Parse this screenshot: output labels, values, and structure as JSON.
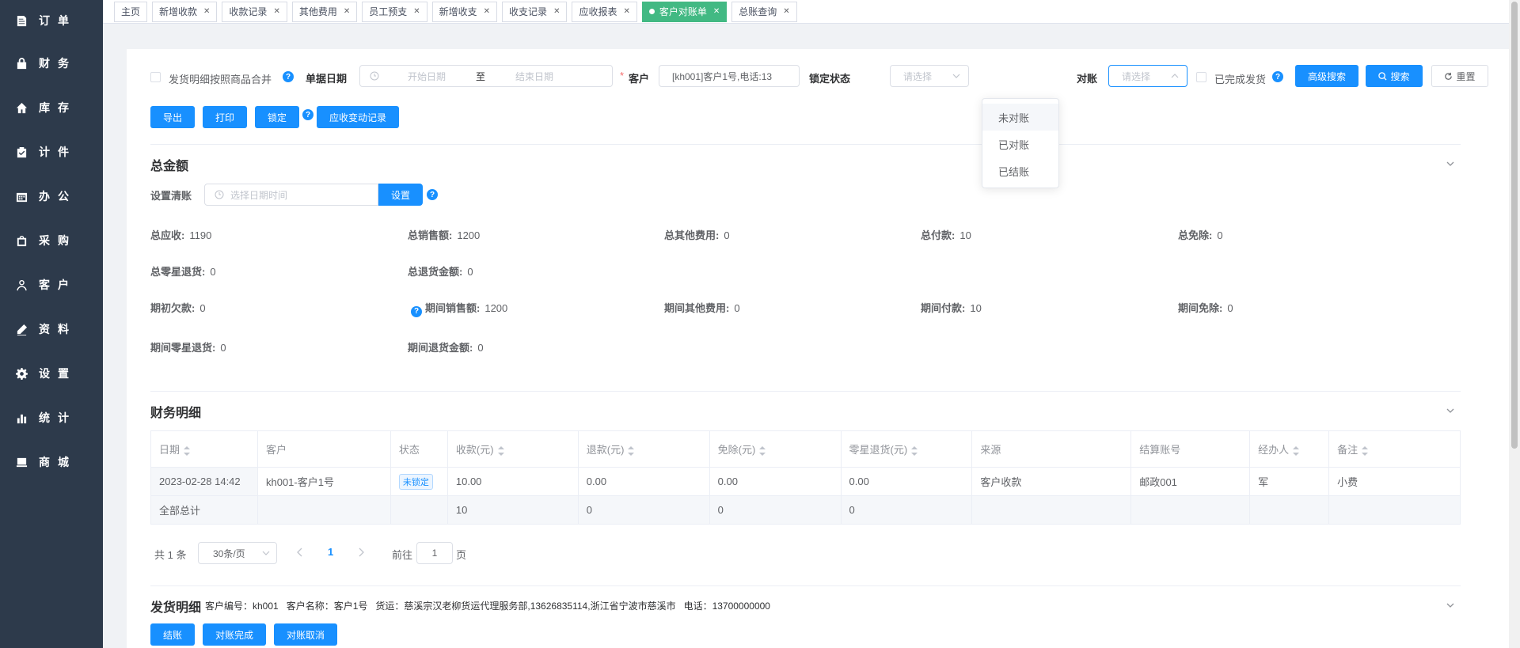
{
  "sidebar": {
    "items": [
      {
        "label": "订单",
        "icon": "order-icon"
      },
      {
        "label": "财务",
        "icon": "finance-icon"
      },
      {
        "label": "库存",
        "icon": "home-icon"
      },
      {
        "label": "计件",
        "icon": "clipboard-icon"
      },
      {
        "label": "办公",
        "icon": "calendar-icon"
      },
      {
        "label": "采购",
        "icon": "bag-icon"
      },
      {
        "label": "客户",
        "icon": "user-icon"
      },
      {
        "label": "资料",
        "icon": "edit-icon"
      },
      {
        "label": "设置",
        "icon": "gear-icon"
      },
      {
        "label": "统计",
        "icon": "bar-chart-icon"
      },
      {
        "label": "商城",
        "icon": "store-icon"
      }
    ]
  },
  "tabs": [
    {
      "label": "主页",
      "closable": false
    },
    {
      "label": "新增收款",
      "closable": true
    },
    {
      "label": "收款记录",
      "closable": true
    },
    {
      "label": "其他费用",
      "closable": true
    },
    {
      "label": "员工预支",
      "closable": true
    },
    {
      "label": "新增收支",
      "closable": true
    },
    {
      "label": "收支记录",
      "closable": true
    },
    {
      "label": "应收报表",
      "closable": true
    },
    {
      "label": "客户对账单",
      "closable": true,
      "active": true
    },
    {
      "label": "总账查询",
      "closable": true
    }
  ],
  "filters": {
    "merge_label": "发货明细按照商品合并",
    "date_label": "单据日期",
    "start_placeholder": "开始日期",
    "date_sep": "至",
    "end_placeholder": "结束日期",
    "required_mark": "*",
    "customer_label": "客户",
    "customer_value": "[kh001]客户1号,电话:13",
    "lock_label": "锁定状态",
    "lock_placeholder": "请选择",
    "reconcile_label": "对账",
    "reconcile_placeholder": "请选择",
    "shipped_label": "已完成发货",
    "advanced_button": "高级搜索",
    "search_button": "搜索",
    "reset_button": "重置"
  },
  "actions": {
    "export": "导出",
    "print": "打印",
    "lock": "锁定",
    "change_log": "应收变动记录"
  },
  "dropdown": {
    "options": [
      "未对账",
      "已对账",
      "已结账"
    ]
  },
  "totals": {
    "title": "总金额",
    "settle_label": "设置清账",
    "settle_placeholder": "选择日期时间",
    "settle_button": "设置",
    "rows": [
      [
        {
          "k": "总应收:",
          "v": "1190"
        },
        {
          "k": "总销售额:",
          "v": "1200"
        },
        {
          "k": "总其他费用:",
          "v": "0"
        },
        {
          "k": "总付款:",
          "v": "10"
        },
        {
          "k": "总免除:",
          "v": "0"
        }
      ],
      [
        {
          "k": "总零星退货:",
          "v": "0"
        },
        {
          "k": "总退货金额:",
          "v": "0"
        }
      ],
      [
        {
          "k": "期初欠款:",
          "v": "0"
        },
        {
          "k": "期间销售额:",
          "v": "1200"
        },
        {
          "k": "期间其他费用:",
          "v": "0"
        },
        {
          "k": "期间付款:",
          "v": "10"
        },
        {
          "k": "期间免除:",
          "v": "0"
        }
      ],
      [
        {
          "k": "期间零星退货:",
          "v": "0"
        },
        {
          "k": "期间退货金额:",
          "v": "0"
        }
      ]
    ]
  },
  "finance": {
    "title": "财务明细",
    "columns": [
      "日期",
      "客户",
      "状态",
      "收款(元)",
      "退款(元)",
      "免除(元)",
      "零星退货(元)",
      "来源",
      "结算账号",
      "经办人",
      "备注"
    ],
    "row": {
      "date": "2023-02-28 14:42",
      "customer": "kh001-客户1号",
      "status": "未锁定",
      "receipt": "10.00",
      "refund": "0.00",
      "waive": "0.00",
      "return": "0.00",
      "source": "客户收款",
      "account": "邮政001",
      "handler": "军",
      "remark": "小费"
    },
    "sum": {
      "label": "全部总计",
      "receipt": "10",
      "refund": "0",
      "waive": "0",
      "return": "0"
    }
  },
  "pagination": {
    "total": "共 1 条",
    "page_size": "30条/页",
    "current": "1",
    "goto_label": "前往",
    "goto_value": "1",
    "page_unit": "页"
  },
  "shipping": {
    "title": "发货明细",
    "info": "客户编号：kh001   客户名称：客户1号   货运：慈溪宗汉老柳货运代理服务部,13626835114,浙江省宁波市慈溪市   电话：13700000000",
    "settle_button": "结账",
    "done_button": "对账完成",
    "cancel_button": "对账取消"
  }
}
